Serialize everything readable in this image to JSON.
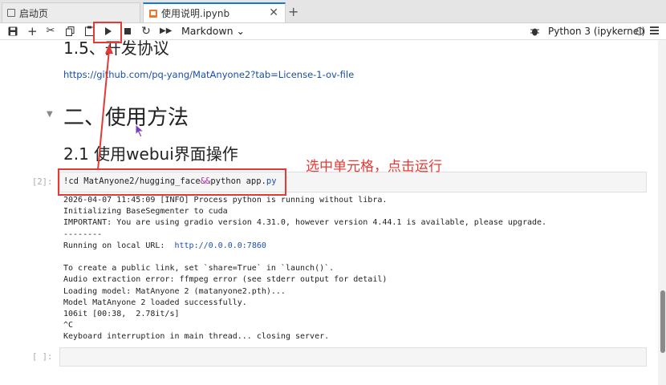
{
  "tabs": [
    {
      "label": "启动页",
      "active": false
    },
    {
      "label": "使用说明.ipynb",
      "active": true
    }
  ],
  "toolbar": {
    "cell_type": "Markdown ⌄",
    "kernel": "Python 3 (ipykernel)"
  },
  "notebook": {
    "heading_protocol": "1.5、开发协议",
    "license_link": "https://github.com/pq-yang/MatAnyone2?tab=License-1-ov-file",
    "heading_usage": "二、使用方法",
    "heading_webui": "2.1 使用webui界面操作",
    "cell1": {
      "prompt": "[2]:",
      "code_prefix": "!cd MatAnyone2/hugging_face",
      "code_amp": "&&",
      "code_cmd": "python app.",
      "code_ext": "py",
      "output": [
        "2026-04-07 11:45:09 [INFO] Process python is running without libra.",
        "Initializing BaseSegmenter to cuda",
        "IMPORTANT: You are using gradio version 4.31.0, however version 4.44.1 is available, please upgrade.",
        "--------",
        "Running on local URL:  ",
        "",
        "To create a public link, set `share=True` in `launch()`.",
        "Audio extraction error: ffmpeg error (see stderr output for detail)",
        "Loading model: MatAnyone 2 (matanyone2.pth)...",
        "Model MatAnyone 2 loaded successfully.",
        "106it [00:38,  2.78it/s]",
        "^C",
        "Keyboard interruption in main thread... closing server."
      ],
      "local_url": "http://0.0.0.0:7860"
    },
    "cell2": {
      "prompt": "[ ]:"
    }
  },
  "annotation": {
    "text": "选中单元格，点击运行",
    "color": "#e53935"
  },
  "icons": [
    "save-icon",
    "add-icon",
    "cut-icon",
    "copy-icon",
    "paste-icon",
    "run-icon",
    "stop-icon",
    "restart-icon",
    "fast-forward-icon",
    "bug-icon",
    "kernel-status-icon",
    "menu-icon"
  ]
}
